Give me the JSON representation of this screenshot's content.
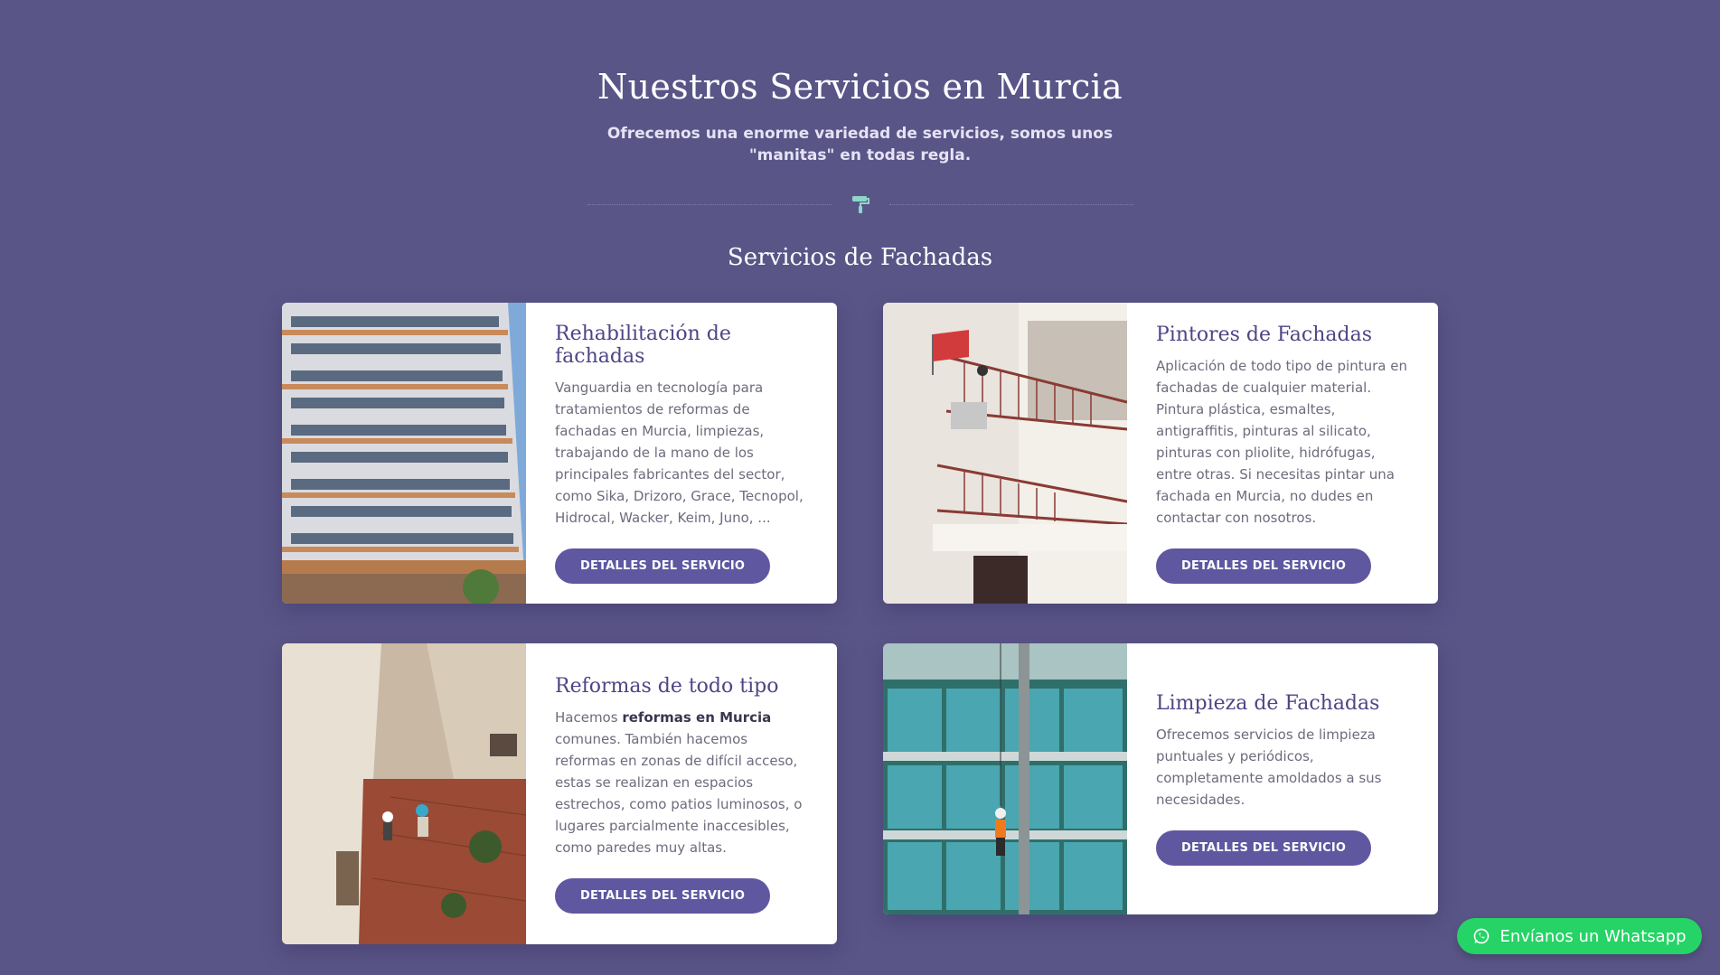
{
  "header": {
    "title": "Nuestros Servicios en Murcia",
    "subtitle": "Ofrecemos una enorme variedad de servicios, somos unos \"manitas\" en todas regla."
  },
  "divider": {
    "icon": "paint-roller-icon",
    "color": "#8fd6c9"
  },
  "section": {
    "title": "Servicios de Fachadas"
  },
  "cards": [
    {
      "title": "Rehabilitación de fachadas",
      "text": "Vanguardia en tecnología para tratamientos de reformas de fachadas en Murcia, limpiezas, trabajando de la mano de los principales fabricantes del sector, como Sika, Drizoro, Grace, Tecnopol, Hidrocal, Wacker, Keim, Juno, ...",
      "button": "DETALLES DEL SERVICIO"
    },
    {
      "title": "Pintores de Fachadas",
      "text": "Aplicación de todo tipo de pintura en fachadas de cualquier material. Pintura plástica, esmaltes, antigraffitis, pinturas al silicato, pinturas con pliolite, hidrófugas, entre otras. Si necesitas pintar una fachada en Murcia, no dudes en contactar con nosotros.",
      "button": "DETALLES DEL SERVICIO"
    },
    {
      "title": "Reformas de todo tipo",
      "text_before": "Hacemos ",
      "text_bold": "reformas en Murcia",
      "text_after": " comunes. También hacemos reformas en zonas de difícil acceso, estas se realizan en espacios estrechos, como patios luminosos, o lugares parcialmente inaccesibles, como paredes muy altas.",
      "button": "DETALLES DEL SERVICIO"
    },
    {
      "title": "Limpieza de Fachadas",
      "text": "Ofrecemos servicios de limpieza puntuales y periódicos, completamente amoldados a sus necesidades.",
      "button": "DETALLES DEL SERVICIO"
    }
  ],
  "whatsapp": {
    "label": "Envíanos un Whatsapp",
    "icon": "whatsapp-icon",
    "color": "#25d366"
  },
  "colors": {
    "background": "#5a5587",
    "accent": "#5f57a0"
  }
}
